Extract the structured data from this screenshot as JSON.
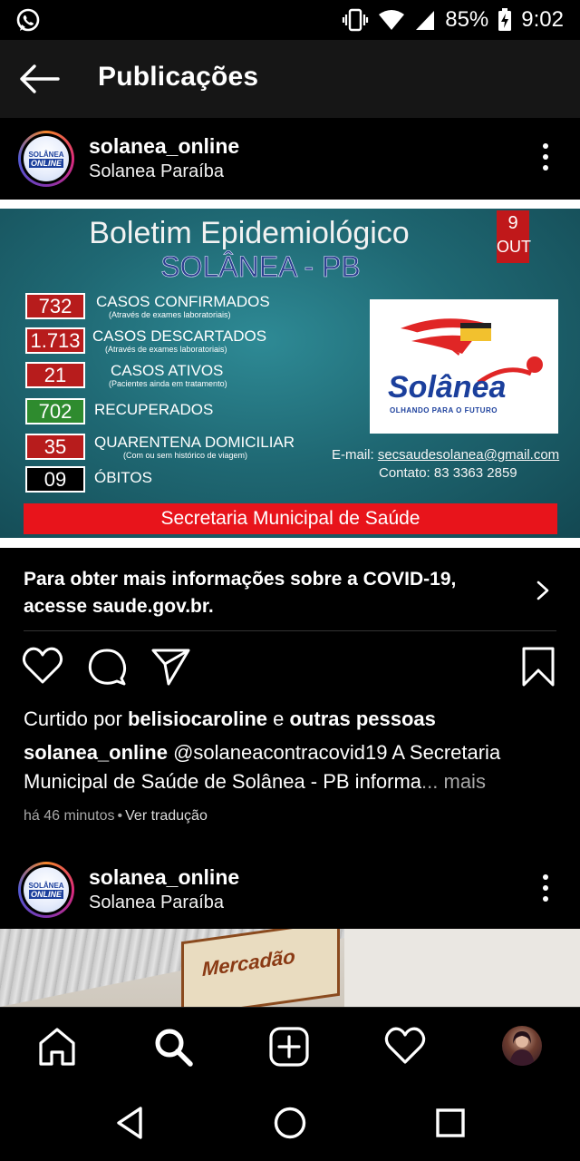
{
  "status_bar": {
    "battery": "85%",
    "time": "9:02"
  },
  "app_bar": {
    "title": "Publicações"
  },
  "post1": {
    "username": "solanea_online",
    "location": "Solanea Paraíba",
    "avatar_text_top": "SOLÂNEA",
    "avatar_text_bottom": "ONLINE",
    "image": {
      "title": "Boletim Epidemiológico",
      "subtitle": "SOLÂNEA - PB",
      "date_day": "9",
      "date_month": "OUT",
      "stats": [
        {
          "value": "732",
          "label": "CASOS CONFIRMADOS",
          "note": "(Através de exames laboratoriais)",
          "color": "#b71c1c"
        },
        {
          "value": "1.713",
          "label": "CASOS DESCARTADOS",
          "note": "(Através de exames laboratoriais)",
          "color": "#b71c1c"
        },
        {
          "value": "21",
          "label": "CASOS ATIVOS",
          "note": "(Pacientes ainda em tratamento)",
          "color": "#b71c1c"
        },
        {
          "value": "702",
          "label": "RECUPERADOS",
          "note": "",
          "color": "#2e8b2e"
        },
        {
          "value": "35",
          "label": "QUARENTENA DOMICILIAR",
          "note": "(Com ou sem histórico de viagem)",
          "color": "#b71c1c"
        },
        {
          "value": "09",
          "label": "ÓBITOS",
          "note": "",
          "color": "#000000"
        }
      ],
      "logo_word": "Solânea",
      "logo_slogan": "OLHANDO PARA O FUTURO",
      "email_label": "E-mail:",
      "email": "secsaudesolanea@gmail.com",
      "contact": "Contato: 83 3363 2859",
      "footer": "Secretaria Municipal de Saúde"
    },
    "covid_notice": "Para obter mais informações sobre a COVID-19, acesse saude.gov.br.",
    "likes_prefix": "Curtido por ",
    "likes_user": "belisiocaroline",
    "likes_middle": " e ",
    "likes_others": "outras pessoas",
    "caption_user": "solanea_online",
    "caption_text": " @solaneacontracovid19 A Secretaria Municipal de Saúde de Solânea - PB informa",
    "caption_more": "... mais",
    "time_ago": "há 46 minutos",
    "separator": "•",
    "translate": "Ver tradução"
  },
  "post2": {
    "username": "solanea_online",
    "location": "Solanea Paraíba",
    "avatar_text_top": "SOLÂNEA",
    "avatar_text_bottom": "ONLINE",
    "sign_text": "Mercadão"
  },
  "icons": {
    "nav": [
      "home-icon",
      "search-icon",
      "add-post-icon",
      "activity-heart-icon",
      "profile-avatar"
    ],
    "system": [
      "back-triangle-icon",
      "home-circle-icon",
      "recents-square-icon"
    ]
  }
}
